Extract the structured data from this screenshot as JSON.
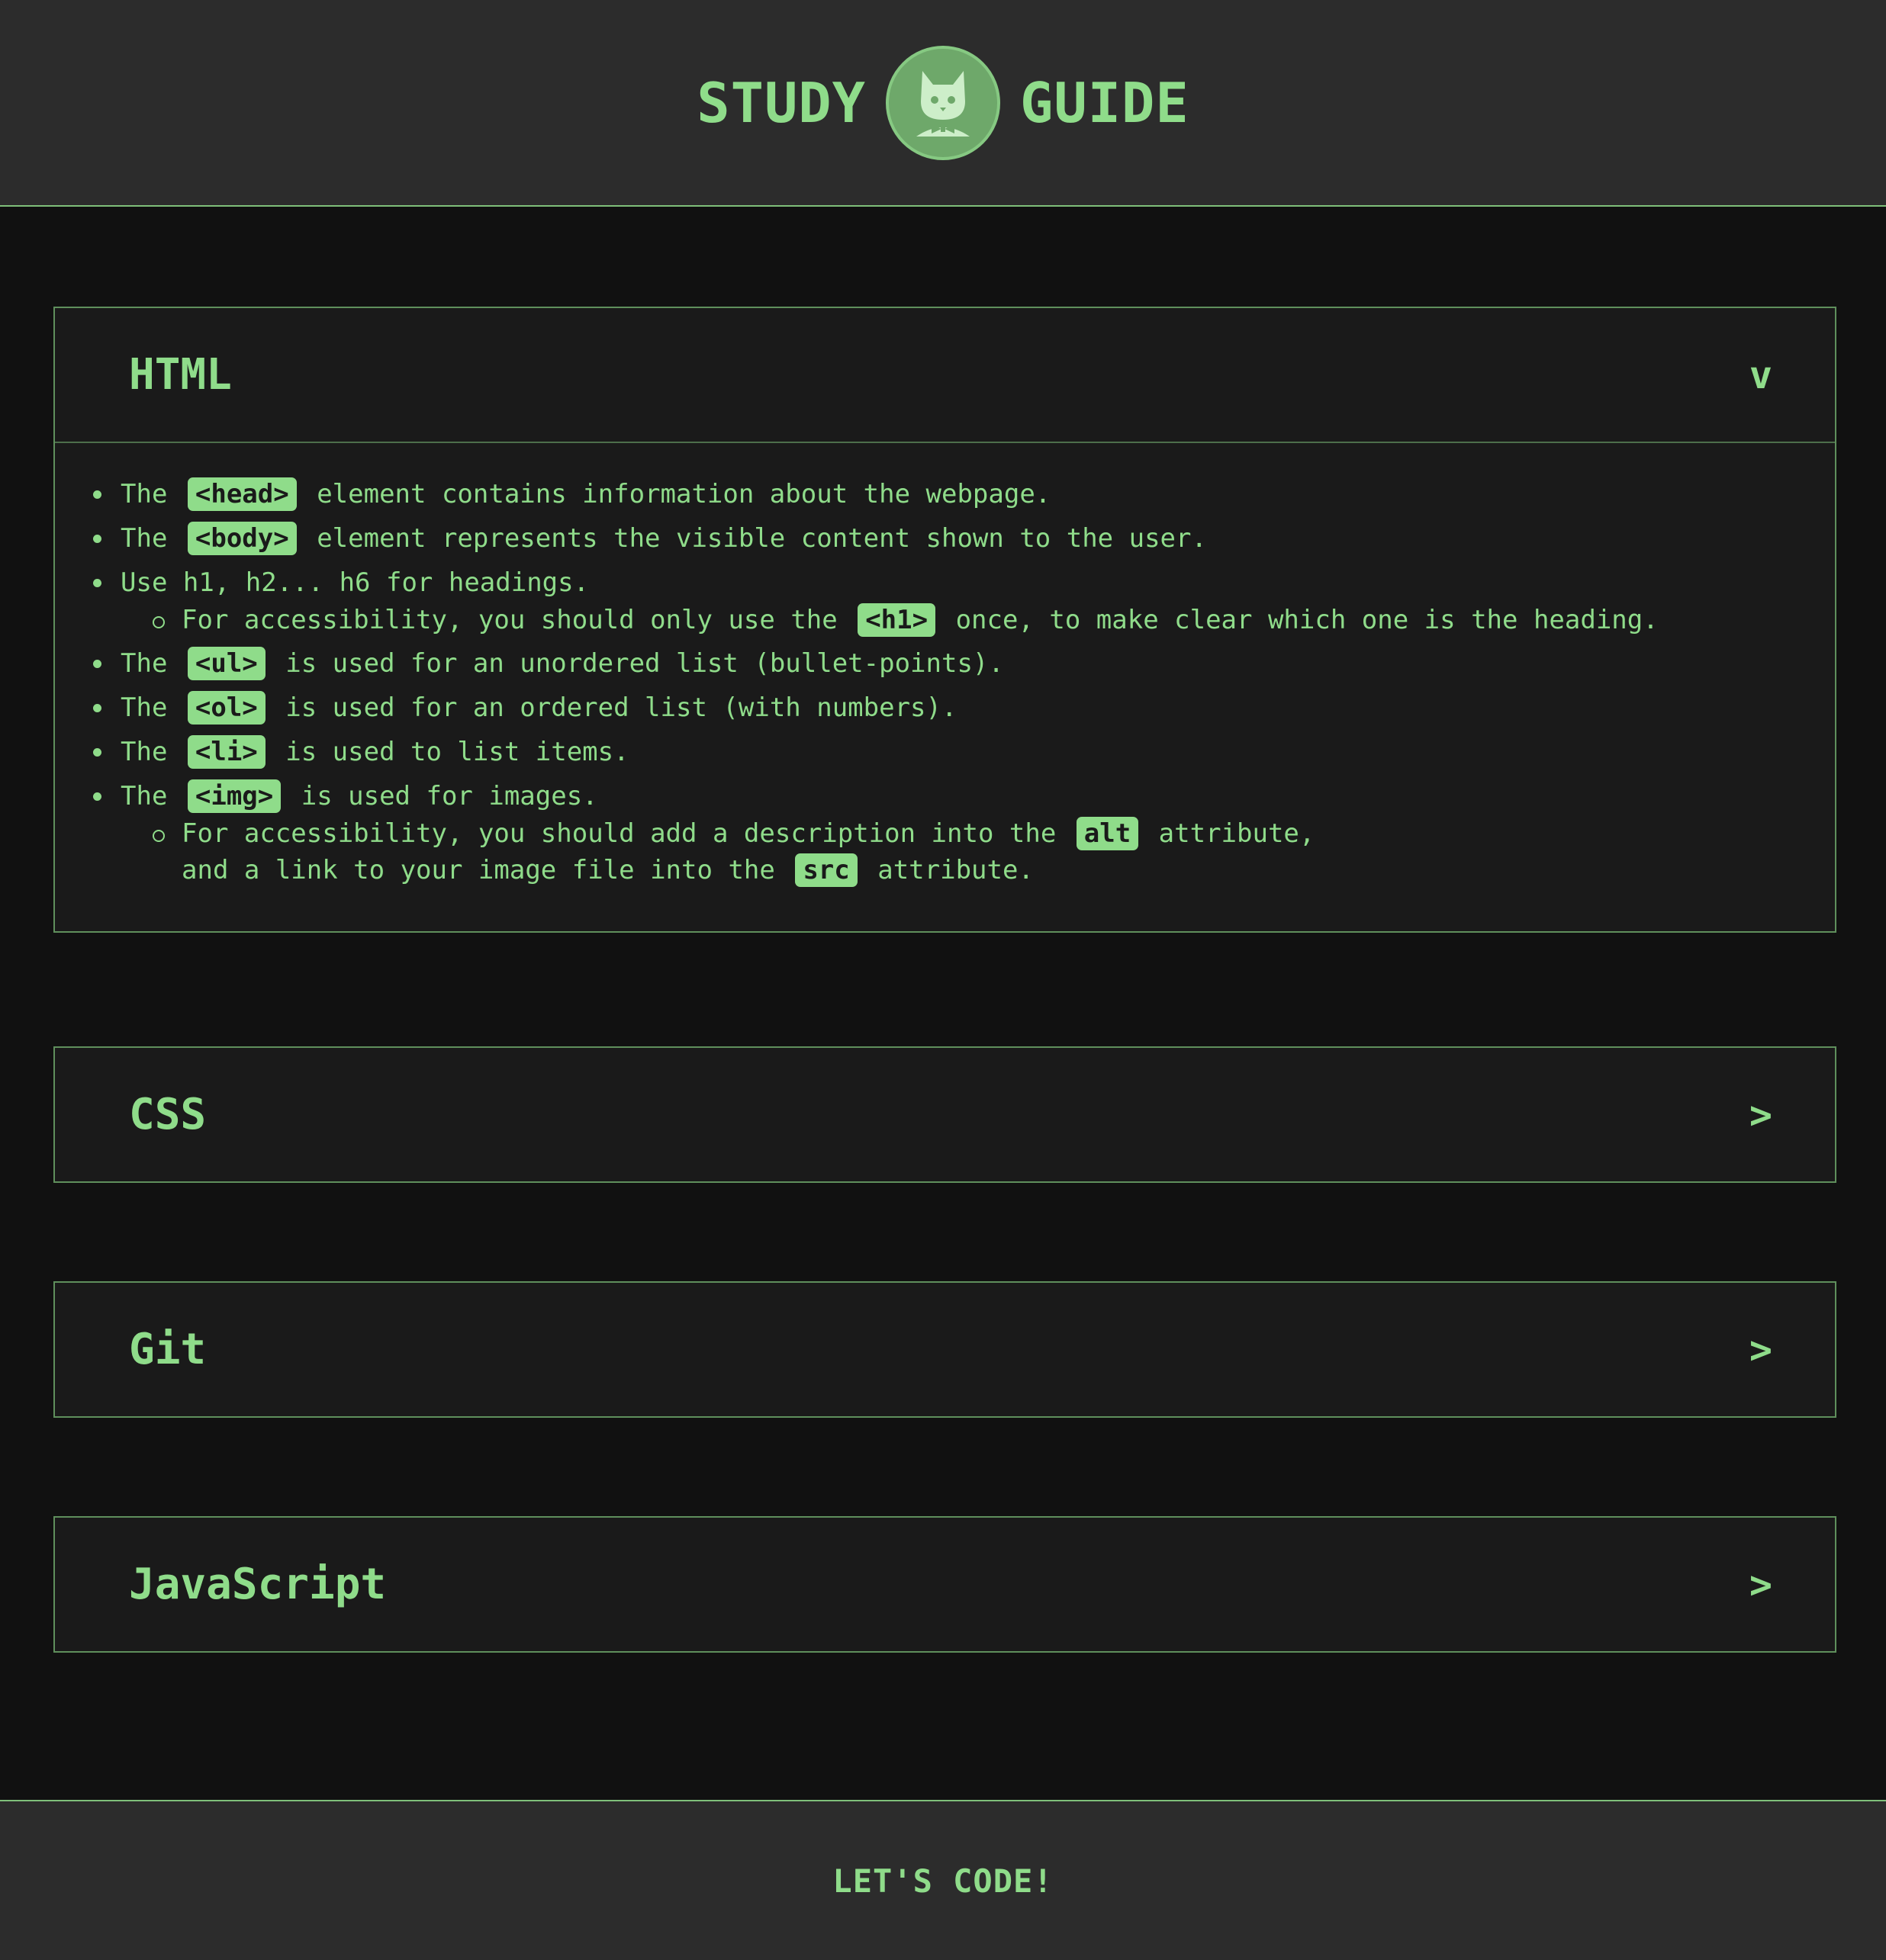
{
  "header": {
    "title_left": "STUDY",
    "title_right": "GUIDE",
    "logo_icon": "cat-bowtie-icon"
  },
  "colors": {
    "accent": "#8fdc8a",
    "background": "#111111",
    "panel": "#1a1a1a",
    "header_bg": "#2c2c2c",
    "logo_bg": "#6ea86a"
  },
  "sections": {
    "html": {
      "title": "HTML",
      "chevron": "v",
      "expanded": true,
      "items": {
        "i0": {
          "pre": "The",
          "code": "<head>",
          "post": "element contains information about the webpage."
        },
        "i1": {
          "pre": "The",
          "code": "<body>",
          "post": "element represents the visible content shown to the user."
        },
        "i2": {
          "text": "Use h1, h2... h6 for headings."
        },
        "i2s": {
          "pre": "For accessibility, you should only use the",
          "code": "<h1>",
          "post": "once, to make clear which one is the heading."
        },
        "i3": {
          "pre": "The",
          "code": "<ul>",
          "post": "is used for an unordered list (bullet-points)."
        },
        "i4": {
          "pre": "The",
          "code": "<ol>",
          "post": "is used for an ordered list (with numbers)."
        },
        "i5": {
          "pre": "The",
          "code": "<li>",
          "post": "is used to list items."
        },
        "i6": {
          "pre": "The",
          "code": "<img>",
          "post": "is used for images."
        },
        "i6s": {
          "pre": "For accessibility, you should add a description into the",
          "code": "alt",
          "post": "attribute,",
          "pre2": "and a link to your image file into the",
          "code2": "src",
          "post2": "attribute."
        }
      }
    },
    "css": {
      "title": "CSS",
      "chevron": ">"
    },
    "git": {
      "title": "Git",
      "chevron": ">"
    },
    "javascript": {
      "title": "JavaScript",
      "chevron": ">"
    }
  },
  "footer": {
    "text": "LET'S CODE!"
  }
}
